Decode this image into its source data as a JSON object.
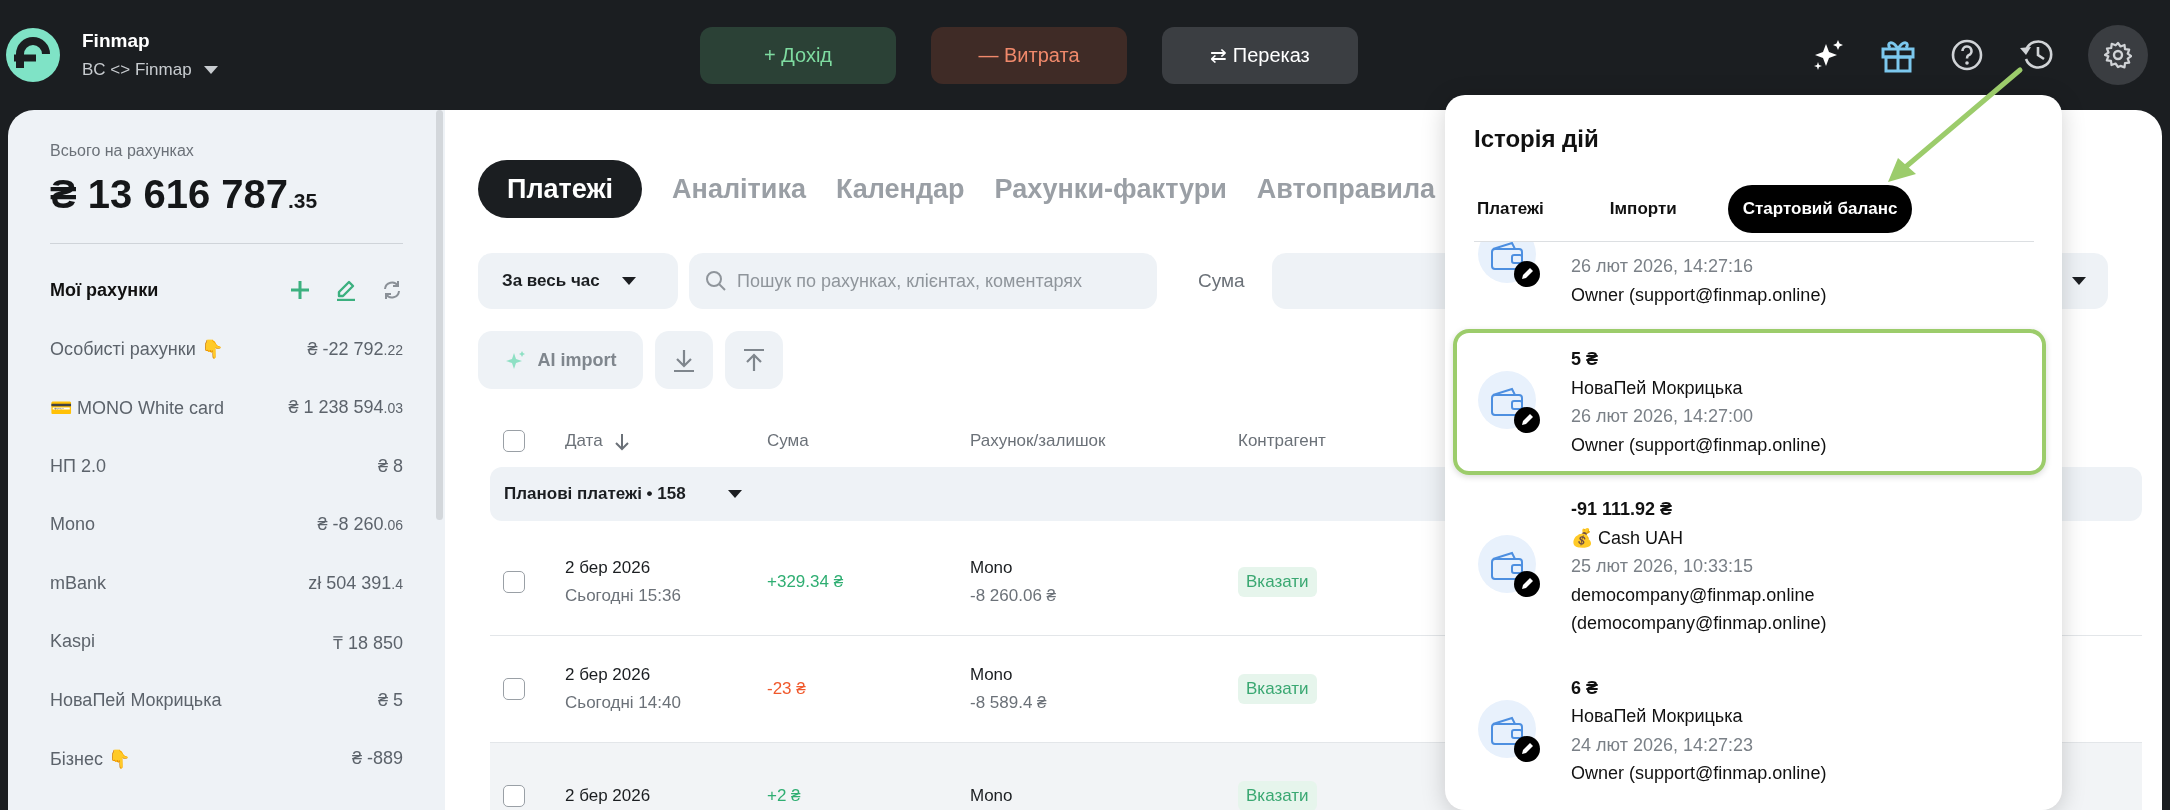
{
  "header": {
    "app_name": "Finmap",
    "workspace": "BC <> Finmap",
    "actions": [
      {
        "kind": "income",
        "label": "+ Дохід"
      },
      {
        "kind": "expense",
        "label": "— Витрата"
      },
      {
        "kind": "transfer",
        "label": "⇄ Переказ"
      }
    ]
  },
  "sidebar": {
    "total_label": "Всього на рахунках",
    "total": "₴ 13 616 787",
    "total_cents": ".35",
    "accounts_title": "Мої рахунки",
    "accounts": [
      {
        "name": "Особисті рахунки 👇",
        "amount": "₴ -22 792",
        "cents": ".22"
      },
      {
        "name": "💳 MONO White card",
        "amount": "₴ 1 238 594",
        "cents": ".03"
      },
      {
        "name": "НП 2.0",
        "amount": "₴ 8"
      },
      {
        "name": "Mono",
        "amount": "₴ -8 260",
        "cents": ".06"
      },
      {
        "name": "mBank",
        "amount": "zł 504 391",
        "cents": ".4"
      },
      {
        "name": "Kaspi",
        "amount": "₸ 18 850"
      },
      {
        "name": "НоваПей Мокрицька",
        "amount": "₴ 5"
      },
      {
        "name": "Бізнес 👇",
        "amount": "₴ -889"
      }
    ]
  },
  "main": {
    "tabs": [
      {
        "label": "Платежі",
        "selected": true
      },
      {
        "label": "Аналітика",
        "selected": false
      },
      {
        "label": "Календар",
        "selected": false
      },
      {
        "label": "Рахунки-фактури",
        "selected": false
      },
      {
        "label": "Автоправила",
        "selected": false
      }
    ],
    "period": "За весь час",
    "search": {
      "placeholder": "Пошук по рахунках, клієнтах, коментарях"
    },
    "amount_filter_label": "Сума",
    "ai_import": "AI import",
    "table": {
      "all_checked": false,
      "columns": [
        "Дата",
        "Сума",
        "Рахунок/залишок",
        "Контрагент"
      ],
      "group": "Планові платежі • 158",
      "rows": [
        {
          "date": "2 бер 2026",
          "time": "Сьогодні 15:36",
          "amount": "+329.34 ₴",
          "kind": "income",
          "account": "Mono",
          "balance": "-8 260.06 ₴",
          "counterparty": "Вказати",
          "hovered": false,
          "checked": false
        },
        {
          "date": "2 бер 2026",
          "time": "Сьогодні 14:40",
          "amount": "-23 ₴",
          "kind": "expense",
          "account": "Mono",
          "balance": "-8 589.4 ₴",
          "counterparty": "Вказати",
          "hovered": false,
          "checked": false
        },
        {
          "date": "2 бер 2026",
          "amount": "+2 ₴",
          "kind": "income",
          "account": "Mono",
          "counterparty": "Вказати",
          "hovered": true,
          "checked": false
        }
      ]
    }
  },
  "history": {
    "title": "Історія дій",
    "tabs": [
      {
        "label": "Платежі",
        "selected": false
      },
      {
        "label": "Імпорти",
        "selected": false
      },
      {
        "label": "Стартовий баланс",
        "selected": true
      }
    ],
    "items": [
      {
        "date": "26 лют 2026, 14:27:16",
        "author": "Owner (support@finmap.online)",
        "highlighted": false
      },
      {
        "amount": "5 ₴",
        "account": "НоваПей Мокрицька",
        "date": "26 лют 2026, 14:27:00",
        "author": "Owner (support@finmap.online)",
        "highlighted": true
      },
      {
        "amount": "-91 111.92 ₴",
        "account": "💰 Cash UAH",
        "date": "25 лют 2026, 10:33:15",
        "author": "democompany@finmap.online (democompany@finmap.online)",
        "highlighted": false
      },
      {
        "amount": "6 ₴",
        "account": "НоваПей Мокрицька",
        "date": "24 лют 2026, 14:27:23",
        "author": "Owner (support@finmap.online)",
        "highlighted": false
      }
    ]
  }
}
